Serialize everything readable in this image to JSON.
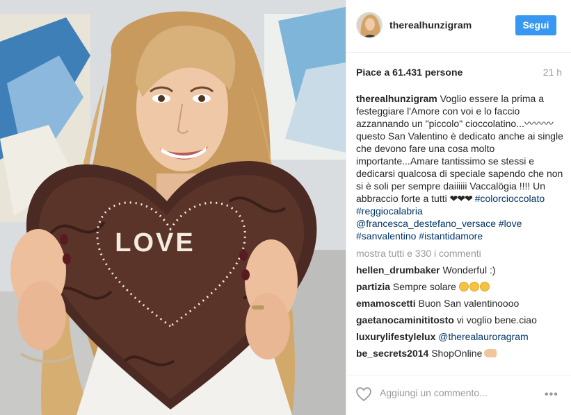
{
  "post": {
    "username": "therealhunzigram",
    "follow_label": "Segui",
    "likes": "Piace a 61.431 persone",
    "timestamp": "21 h",
    "photo_text": "LOVE",
    "caption": {
      "username": "therealhunzigram",
      "text": "Voglio essere la prima a festeggiare l'Amore con voi e lo faccio azzannando un \"piccolo\" cioccolatino...〰〰〰 questo San Valentino è dedicato anche ai single che devono fare una cosa molto importante...Amare tantissimo se stessi e dedicarsi qualcosa di speciale sapendo che non si è soli per sempre daiiiiii Vaccalögia !!!! Un abbraccio forte a tutti ",
      "hearts": "❤❤❤",
      "tags": [
        "#colorcioccolato",
        "#reggiocalabria",
        "@francesca_destefano_versace",
        "#love",
        "#sanvalentino",
        "#istantidamore"
      ]
    },
    "view_all": "mostra tutti e 330 i commenti",
    "comments": [
      {
        "user": "hellen_drumbaker",
        "text": "Wonderful :)"
      },
      {
        "user": "partizia",
        "text": "Sempre solare"
      },
      {
        "user": "emamoscetti",
        "text": "Buon San valentinoooo"
      },
      {
        "user": "gaetanocaminititosto",
        "text": "vi voglio bene.ciao"
      },
      {
        "user": "luxurylifestylelux",
        "text": "@therealauroragram"
      },
      {
        "user": "be_secrets2014",
        "text": "ShopOnline"
      }
    ],
    "comment_placeholder": "Aggiungi un commento...",
    "more_label": "•••",
    "icons": {
      "like": "heart-outline-icon",
      "options": "more-options-icon",
      "emoji": "smiling-face-icon",
      "hand": "backhand-index-pointing-left-icon"
    },
    "colors": {
      "follow_button": "#3897f0",
      "link": "#003569",
      "muted": "#999999"
    }
  }
}
